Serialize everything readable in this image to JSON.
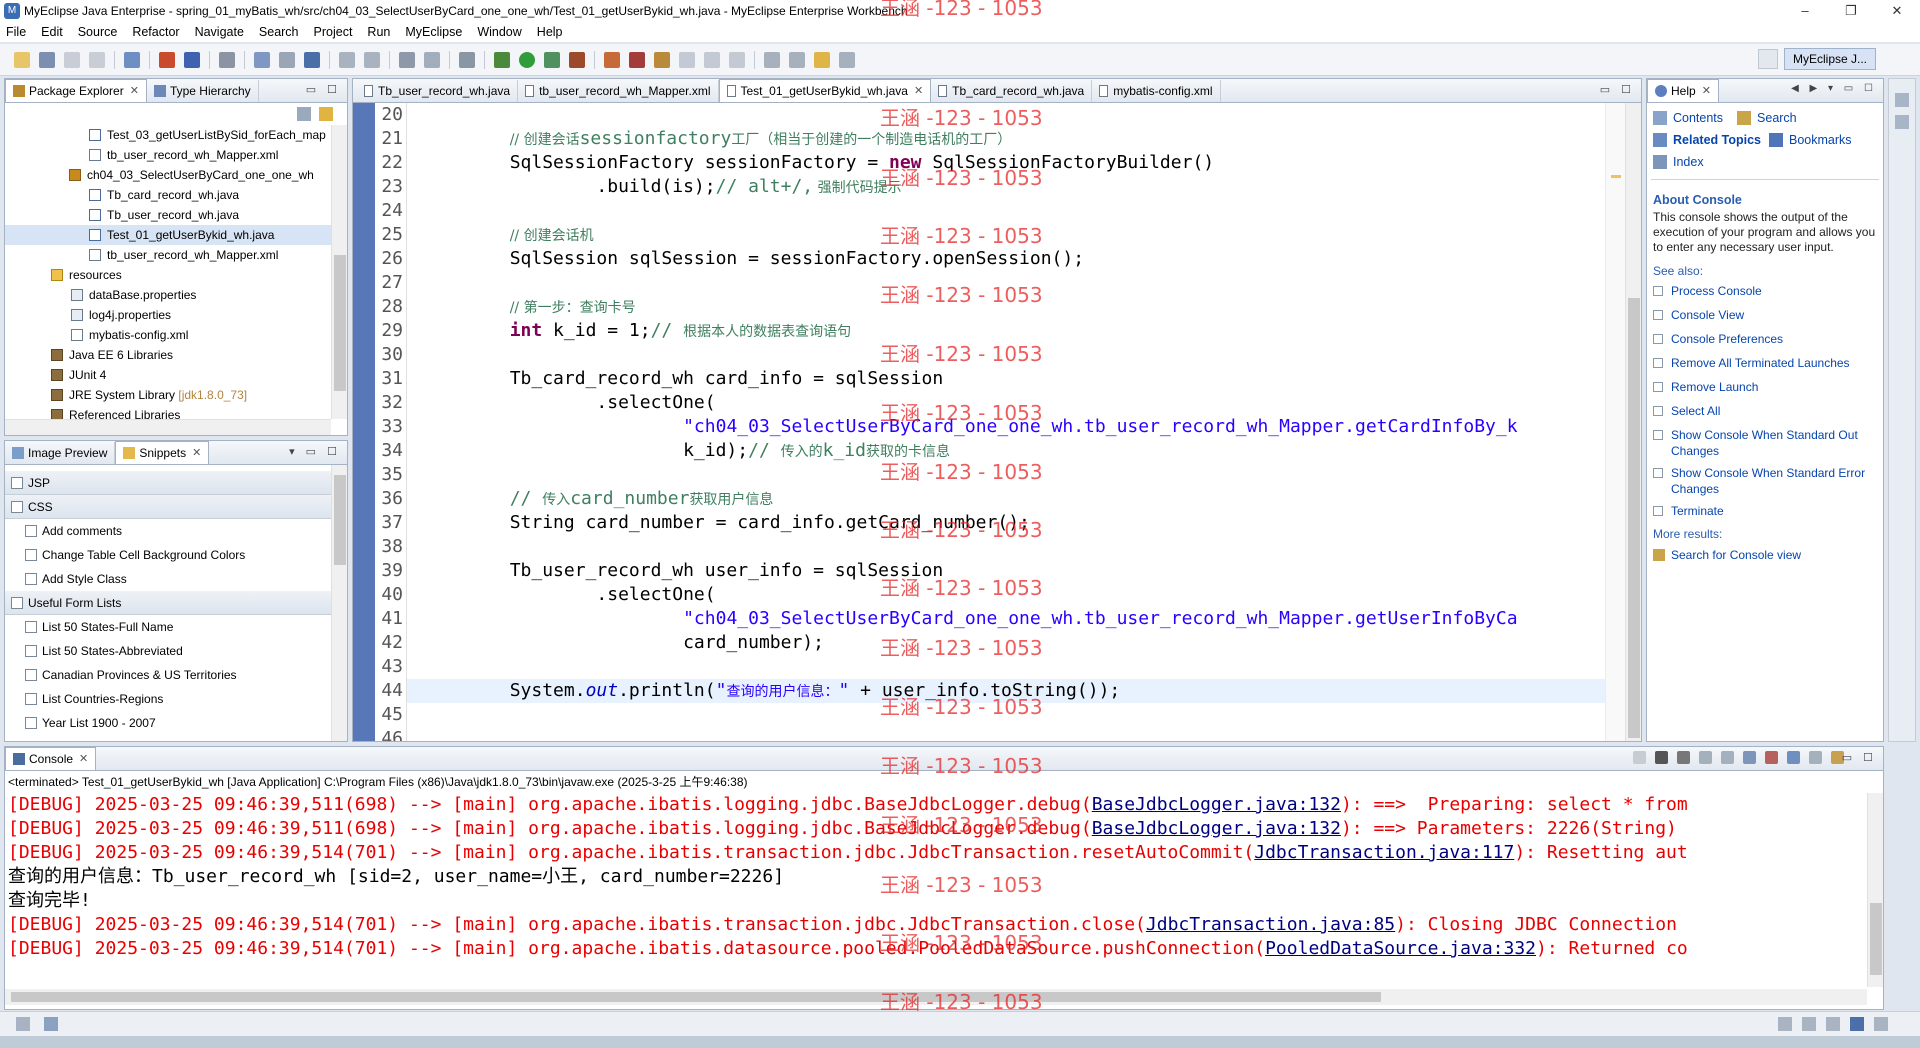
{
  "window": {
    "title": "MyEclipse Java Enterprise - spring_01_myBatis_wh/src/ch04_03_SelectUserByCard_one_one_wh/Test_01_getUserBykid_wh.java - MyEclipse Enterprise Workbench",
    "minimize": "–",
    "maximize": "❐",
    "close": "✕"
  },
  "menu": [
    "File",
    "Edit",
    "Source",
    "Refactor",
    "Navigate",
    "Search",
    "Project",
    "Run",
    "MyEclipse",
    "Window",
    "Help"
  ],
  "perspective": {
    "current": "MyEclipse J..."
  },
  "package_explorer": {
    "tabs": [
      "Package Explorer",
      "Type Hierarchy"
    ],
    "items": [
      {
        "label": "Test_03_getUserListBySid_forEach_map",
        "icon": "java-file-icon"
      },
      {
        "label": "tb_user_record_wh_Mapper.xml",
        "icon": "xml-file-icon"
      },
      {
        "label": "ch04_03_SelectUserByCard_one_one_wh",
        "icon": "package-icon"
      },
      {
        "label": "Tb_card_record_wh.java",
        "icon": "java-file-icon"
      },
      {
        "label": "Tb_user_record_wh.java",
        "icon": "java-file-icon"
      },
      {
        "label": "Test_01_getUserBykid_wh.java",
        "icon": "java-file-icon"
      },
      {
        "label": "tb_user_record_wh_Mapper.xml",
        "icon": "xml-file-icon"
      },
      {
        "label": "resources",
        "icon": "folder-icon"
      },
      {
        "label": "dataBase.properties",
        "icon": "properties-file-icon"
      },
      {
        "label": "log4j.properties",
        "icon": "properties-file-icon"
      },
      {
        "label": "mybatis-config.xml",
        "icon": "xml-file-icon"
      },
      {
        "label": "Java EE 6 Libraries",
        "icon": "library-icon"
      },
      {
        "label": "JUnit 4",
        "icon": "library-icon"
      },
      {
        "label": "JRE System Library",
        "icon": "library-icon",
        "suffix": "[jdk1.8.0_73]"
      },
      {
        "label": "Referenced Libraries",
        "icon": "library-icon"
      }
    ]
  },
  "snippets": {
    "tabs": [
      "Image Preview",
      "Snippets"
    ],
    "groups": [
      {
        "label": "JSP",
        "items": []
      },
      {
        "label": "CSS",
        "items": [
          "Add comments",
          "Change Table Cell Background Colors",
          "Add Style Class"
        ]
      },
      {
        "label": "Useful Form Lists",
        "items": [
          "List 50 States-Full Name",
          "List 50 States-Abbreviated",
          "Canadian Provinces & US Territories",
          "List Countries-Regions",
          "Year List 1900 - 2007"
        ]
      }
    ]
  },
  "editor": {
    "tabs": [
      "Tb_user_record_wh.java",
      "tb_user_record_wh_Mapper.xml",
      "Test_01_getUserBykid_wh.java",
      "Tb_card_record_wh.java",
      "mybatis-config.xml"
    ],
    "active_tab": 2,
    "line_numbers": [
      "20",
      "21",
      "22",
      "23",
      "24",
      "25",
      "26",
      "27",
      "28",
      "29",
      "30",
      "31",
      "32",
      "33",
      "34",
      "35",
      "36",
      "37",
      "38",
      "39",
      "40",
      "41",
      "42",
      "43",
      "44",
      "45",
      "46"
    ]
  },
  "console": {
    "tab": "Console",
    "header": "<terminated> Test_01_getUserBykid_wh [Java Application] C:\\Program Files (x86)\\Java\\jdk1.8.0_73\\bin\\javaw.exe (2025-3-25 上午9:46:38)",
    "lines": [
      {
        "type": "debug",
        "pre": "[DEBUG] 2025-03-25 09:46:39,511(698) --> [main] org.apache.ibatis.logging.jdbc.BaseJdbcLogger.debug(",
        "link": "BaseJdbcLogger.java:132",
        "post": "): ==>  Preparing: select * from"
      },
      {
        "type": "debug",
        "pre": "[DEBUG] 2025-03-25 09:46:39,511(698) --> [main] org.apache.ibatis.logging.jdbc.BaseJdbcLogger.debug(",
        "link": "BaseJdbcLogger.java:132",
        "post": "): ==> Parameters: 2226(String)"
      },
      {
        "type": "debug",
        "pre": "[DEBUG] 2025-03-25 09:46:39,514(701) --> [main] org.apache.ibatis.transaction.jdbc.JdbcTransaction.resetAutoCommit(",
        "link": "JdbcTransaction.java:117",
        "post": "): Resetting aut"
      },
      {
        "type": "out",
        "pre": "查询的用户信息：Tb_user_record_wh [sid=2, user_name=小王, card_number=2226]",
        "link": "",
        "post": ""
      },
      {
        "type": "out",
        "pre": "查询完毕!",
        "link": "",
        "post": ""
      },
      {
        "type": "debug",
        "pre": "[DEBUG] 2025-03-25 09:46:39,514(701) --> [main] org.apache.ibatis.transaction.jdbc.JdbcTransaction.close(",
        "link": "JdbcTransaction.java:85",
        "post": "): Closing JDBC Connection"
      },
      {
        "type": "debug",
        "pre": "[DEBUG] 2025-03-25 09:46:39,514(701) --> [main] org.apache.ibatis.datasource.pooled.PooledDataSource.pushConnection(",
        "link": "PooledDataSource.java:332",
        "post": "): Returned co"
      }
    ]
  },
  "help": {
    "tab": "Help",
    "contents": "Contents",
    "search": "Search",
    "related_topics": "Related Topics",
    "bookmarks": "Bookmarks",
    "index": "Index",
    "about_title": "About Console",
    "about_text": "This console shows the output of the execution of your program and allows you to enter any necessary user input.",
    "see_also": "See also:",
    "links": [
      "Process Console",
      "Console View",
      "Console Preferences",
      "Remove All Terminated Launches",
      "Remove Launch",
      "Select All",
      "Show Console When Standard Out Changes",
      "Show Console When Standard Error Changes",
      "Terminate"
    ],
    "more_results": "More results:",
    "search_link": "Search for Console view"
  },
  "watermark": "王涵 -123 - 1053",
  "colors": {
    "keyword": "#7f0055",
    "comment": "#3f7f5f",
    "string": "#2a00ff",
    "debug": "#e80000",
    "link": "#0645ad",
    "field_italic": "#0000c0"
  }
}
